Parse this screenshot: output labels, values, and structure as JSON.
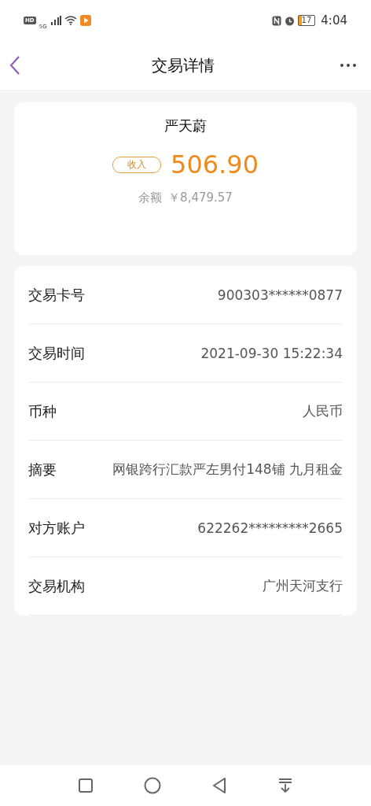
{
  "status_bar": {
    "hd": "HD",
    "network": "5G",
    "battery": "17",
    "time": "4:04"
  },
  "header": {
    "title": "交易详情"
  },
  "summary": {
    "name": "严天蔚",
    "tag": "收入",
    "amount": "506.90",
    "balance_label": "余额",
    "balance": "￥8,479.57"
  },
  "details": [
    {
      "label": "交易卡号",
      "value": "900303******0877"
    },
    {
      "label": "交易时间",
      "value": "2021-09-30 15:22:34"
    },
    {
      "label": "币种",
      "value": "人民币"
    },
    {
      "label": "摘要",
      "value": "网银跨行汇款严左男付148铺 九月租金"
    },
    {
      "label": "对方账户",
      "value": "622262*********2665"
    },
    {
      "label": "交易机构",
      "value": "广州天河支行"
    }
  ]
}
